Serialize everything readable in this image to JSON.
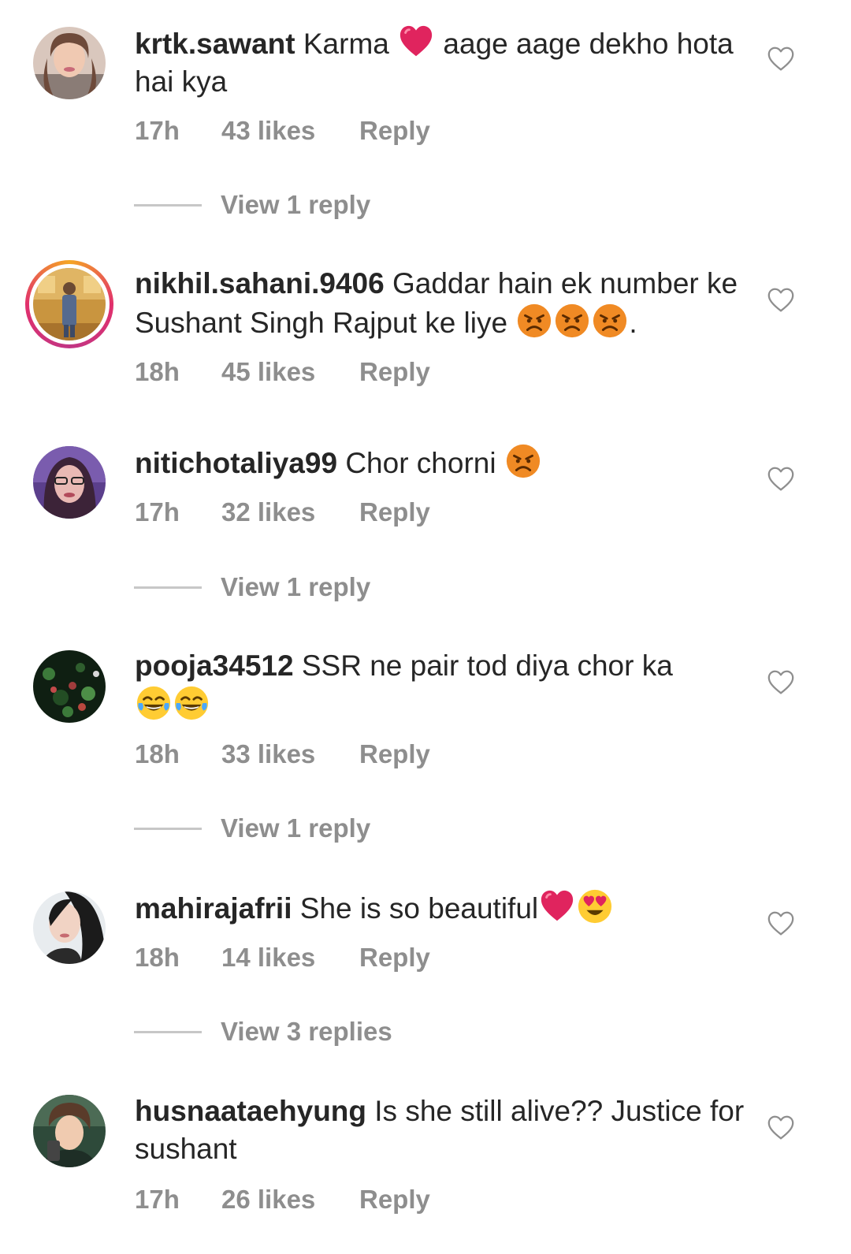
{
  "comments": [
    {
      "username": "krtk.sawant",
      "text_parts": [
        "Karma ",
        " aage aage dekho hota hai kya"
      ],
      "emojis": [
        "red-heart-emoji"
      ],
      "time": "17h",
      "likes": "43 likes",
      "reply": "Reply",
      "view_replies": "View 1 reply"
    },
    {
      "username": "nikhil.sahani.9406",
      "text_parts": [
        "Gaddar hain ek number ke Sushant Singh Rajput ke liye ",
        "."
      ],
      "emojis": [
        "angry-face-emoji",
        "angry-face-emoji",
        "angry-face-emoji"
      ],
      "time": "18h",
      "likes": "45 likes",
      "reply": "Reply"
    },
    {
      "username": "nitichotaliya99",
      "text_parts": [
        "Chor chorni "
      ],
      "emojis": [
        "angry-face-emoji"
      ],
      "time": "17h",
      "likes": "32 likes",
      "reply": "Reply",
      "view_replies": "View 1 reply"
    },
    {
      "username": "pooja34512",
      "text_parts": [
        "SSR ne pair tod diya chor ka "
      ],
      "emojis": [
        "tears-of-joy-emoji",
        "tears-of-joy-emoji"
      ],
      "time": "18h",
      "likes": "33 likes",
      "reply": "Reply",
      "view_replies": "View 1 reply"
    },
    {
      "username": "mahirajafrii",
      "text_parts": [
        "She is so beautiful"
      ],
      "emojis": [
        "red-heart-emoji",
        "heart-eyes-emoji"
      ],
      "time": "18h",
      "likes": "14 likes",
      "reply": "Reply",
      "view_replies": "View 3 replies"
    },
    {
      "username": "husnaataehyung",
      "text_parts": [
        "Is she still alive?? Justice for sushant"
      ],
      "emojis": [],
      "time": "17h",
      "likes": "26 likes",
      "reply": "Reply"
    }
  ],
  "colors": {
    "text": "#262626",
    "meta": "#8e8e8e",
    "divider": "#c7c7c7",
    "heart_emoji": "#e0245e",
    "angry_emoji": "#f08a24"
  }
}
